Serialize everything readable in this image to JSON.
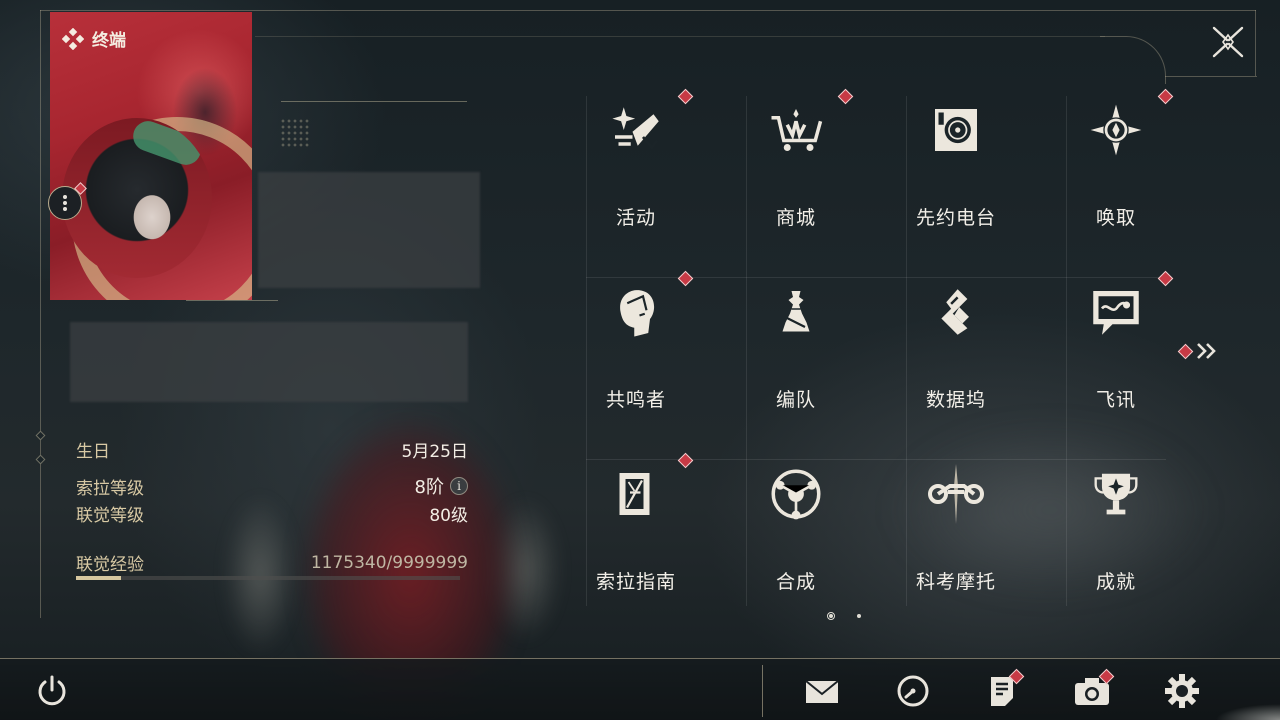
{
  "card": {
    "tag": "终端",
    "tag_icon": "diamond-cluster-icon",
    "more_icon": "vertical-ellipsis-icon"
  },
  "profile": {
    "birthday_label": "生日",
    "birthday_value": "5月25日",
    "sola_level_label": "索拉等级",
    "sola_level_value": "8阶",
    "info_icon": "i",
    "union_level_label": "联觉等级",
    "union_level_value": "80级",
    "union_exp_label": "联觉经验",
    "union_exp_value": "1175340/9999999",
    "union_exp_fraction": 0.1175
  },
  "menu": {
    "items": [
      {
        "label": "活动",
        "icon": "event-sparkle-icon",
        "badge": true
      },
      {
        "label": "商城",
        "icon": "shop-cart-icon",
        "badge": true
      },
      {
        "label": "先约电台",
        "icon": "radio-icon",
        "badge": false
      },
      {
        "label": "唤取",
        "icon": "summon-compass-icon",
        "badge": true
      },
      {
        "label": "共鸣者",
        "icon": "resonator-head-icon",
        "badge": true
      },
      {
        "label": "编队",
        "icon": "team-chess-icon",
        "badge": false
      },
      {
        "label": "数据坞",
        "icon": "data-dock-icon",
        "badge": false
      },
      {
        "label": "飞讯",
        "icon": "message-chat-icon",
        "badge": true
      },
      {
        "label": "索拉指南",
        "icon": "guide-book-icon",
        "badge": true
      },
      {
        "label": "合成",
        "icon": "synthesis-icon",
        "badge": false
      },
      {
        "label": "科考摩托",
        "icon": "motorcycle-icon",
        "badge": false
      },
      {
        "label": "成就",
        "icon": "trophy-icon",
        "badge": false
      }
    ],
    "next_icon": "double-chevron-right-icon",
    "page_count": 2,
    "current_page": 1
  },
  "bottom": {
    "power_icon": "power-icon",
    "mail_icon": "mail-icon",
    "clock_icon": "clock-icon",
    "notice_icon": "notice-icon",
    "camera_icon": "camera-icon",
    "settings_icon": "gear-icon"
  },
  "colors": {
    "accent_gold": "#d8c9a4",
    "badge_red": "#c73a45",
    "card_red": "#a82630"
  }
}
